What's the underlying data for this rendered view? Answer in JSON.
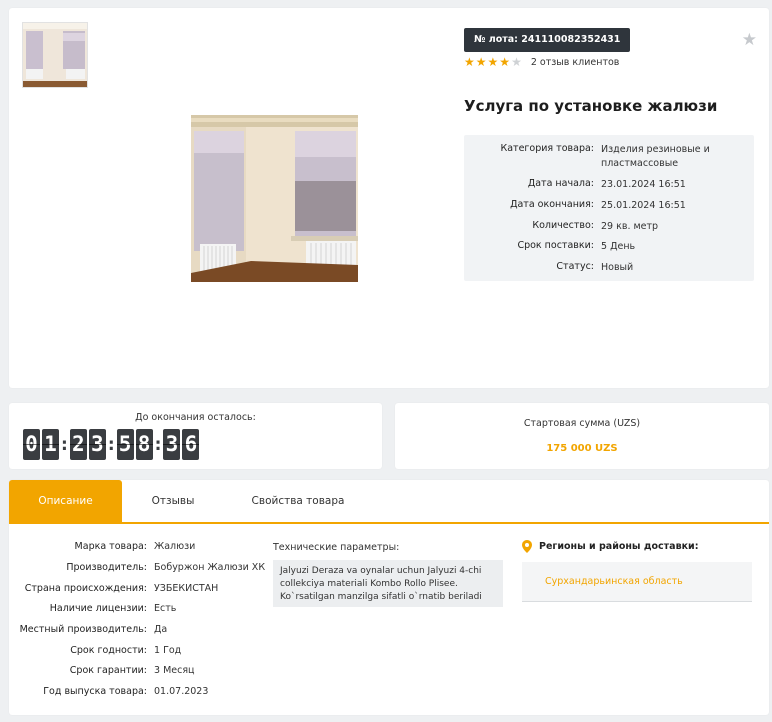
{
  "product": {
    "lot_label": "№ лота: 241110082352431",
    "rating": 4,
    "rating_max": 5,
    "reviews_text": "2 отзыв клиентов",
    "title": "Услуга по установке жалюзи",
    "info": [
      {
        "label": "Категория товара:",
        "value": "Изделия резиновые и пластмассовые"
      },
      {
        "label": "Дата начала:",
        "value": "23.01.2024 16:51"
      },
      {
        "label": "Дата окончания:",
        "value": "25.01.2024 16:51"
      },
      {
        "label": "Количество:",
        "value": "29 кв. метр"
      },
      {
        "label": "Срок поставки:",
        "value": "5 День"
      },
      {
        "label": "Статус:",
        "value": "Новый"
      }
    ]
  },
  "timer": {
    "label": "До окончания осталось:",
    "digits": [
      "0",
      "1",
      "2",
      "3",
      "5",
      "8",
      "3",
      "6"
    ]
  },
  "start_sum": {
    "label": "Стартовая сумма (UZS)",
    "value": "175 000 UZS"
  },
  "tabs": [
    {
      "label": "Описание",
      "active": true
    },
    {
      "label": "Отзывы",
      "active": false
    },
    {
      "label": "Свойства товара",
      "active": false
    }
  ],
  "specs": [
    {
      "label": "Марка товара:",
      "value": "Жалюзи"
    },
    {
      "label": "Производитель:",
      "value": "Бобуржон Жалюзи ХК"
    },
    {
      "label": "Страна происхождения:",
      "value": "УЗБЕКИСТАН"
    },
    {
      "label": "Наличие лицензии:",
      "value": "Есть"
    },
    {
      "label": "Местный производитель:",
      "value": "Да"
    },
    {
      "label": "Срок годности:",
      "value": "1 Год"
    },
    {
      "label": "Срок гарантии:",
      "value": "3 Месяц"
    },
    {
      "label": "Год выпуска товара:",
      "value": "01.07.2023"
    }
  ],
  "technical": {
    "title": "Технические параметры:",
    "lines": [
      "Jalyuzi Deraza va oynalar uchun Jalyuzi 4-chi",
      "collekciya materiali Kombo Rollo Plisee.",
      "Ko`rsatilgan manzilga sifatli o`rnatib beriladi"
    ]
  },
  "regions": {
    "title": "Регионы и районы доставки:",
    "items": [
      "Сурхандарьинская область"
    ]
  },
  "colors": {
    "accent": "#f2a500",
    "badge_bg": "#2f353c",
    "digit_bg": "#3a3d41"
  },
  "icons": {
    "favorite": "star-icon",
    "rating": "star-icon",
    "region": "map-pin-icon"
  }
}
